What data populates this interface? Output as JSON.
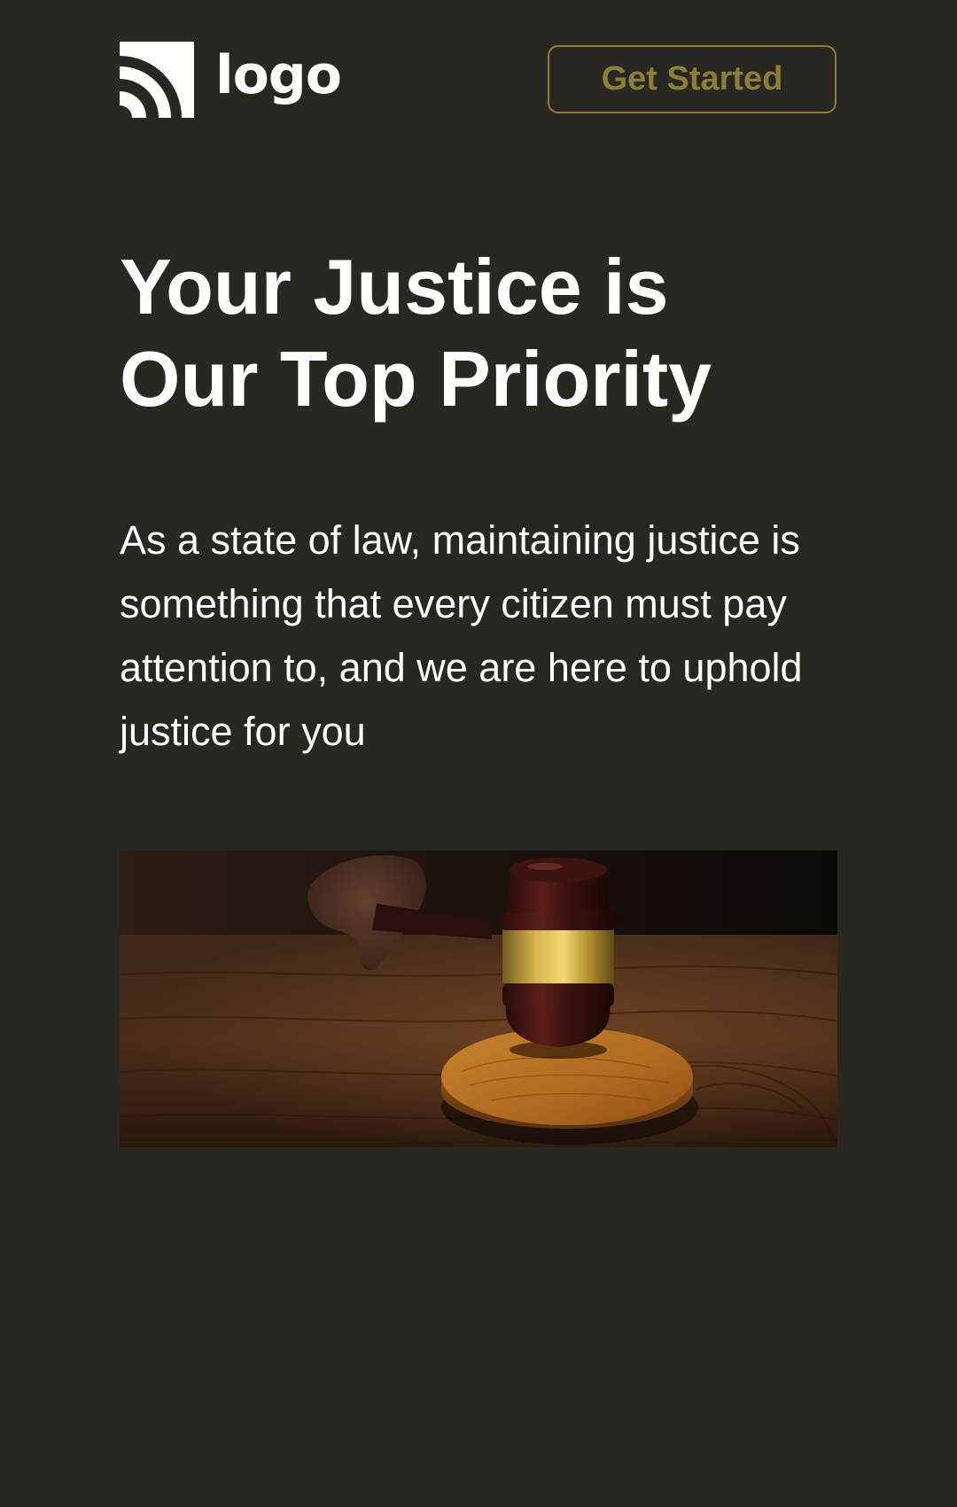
{
  "header": {
    "logo_text": "logo",
    "cta_label": "Get Started"
  },
  "hero": {
    "headline_line1": "Your Justice is",
    "headline_line2": "Our Top Priority",
    "description": "As a state of law, maintaining justice is something that every citizen must pay attention to, and we are here to uphold justice for you",
    "image": {
      "subject": "gavel-on-sound-block"
    }
  },
  "colors": {
    "background": "#282722",
    "accent": "#8c7f35",
    "text": "#ffffff"
  }
}
